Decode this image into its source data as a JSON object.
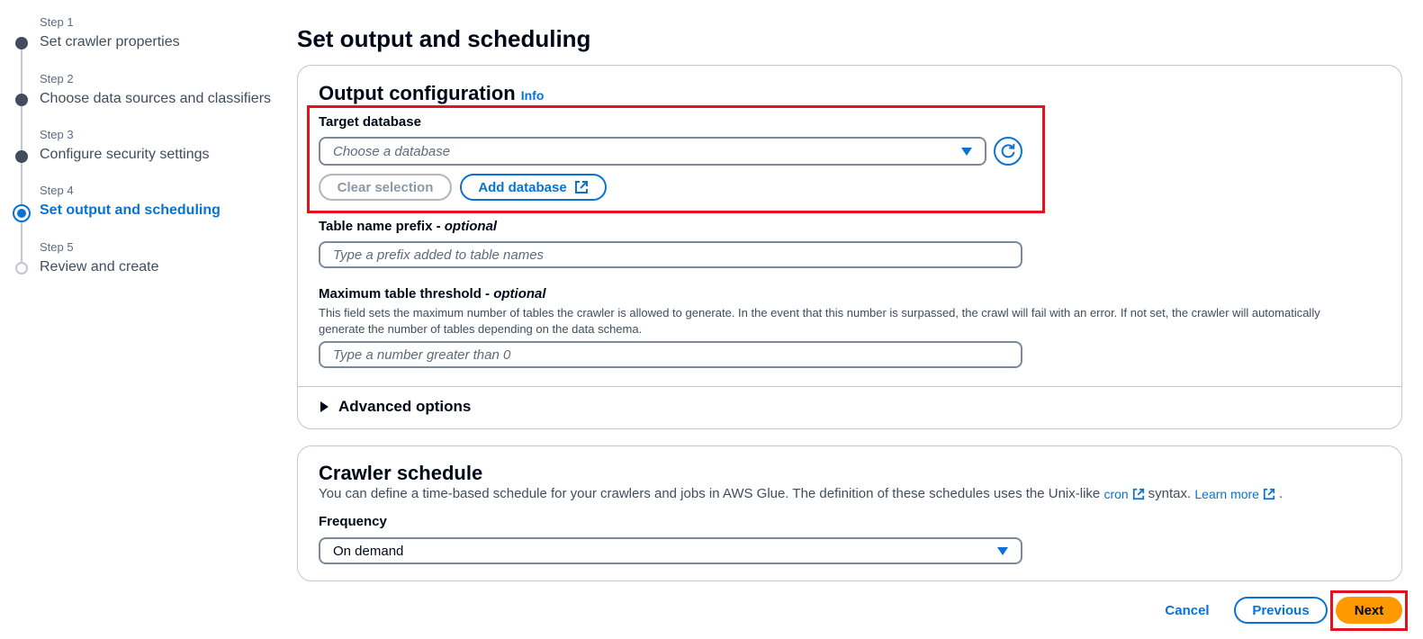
{
  "steps": [
    {
      "number": "Step 1",
      "title": "Set crawler properties",
      "state": "complete"
    },
    {
      "number": "Step 2",
      "title": "Choose data sources and classifiers",
      "state": "complete"
    },
    {
      "number": "Step 3",
      "title": "Configure security settings",
      "state": "complete"
    },
    {
      "number": "Step 4",
      "title": "Set output and scheduling",
      "state": "current"
    },
    {
      "number": "Step 5",
      "title": "Review and create",
      "state": "pending"
    }
  ],
  "page": {
    "title": "Set output and scheduling"
  },
  "output": {
    "title": "Output configuration",
    "info_label": "Info",
    "target_database": {
      "label": "Target database",
      "placeholder": "Choose a database",
      "clear_label": "Clear selection",
      "add_label": "Add database"
    },
    "table_prefix": {
      "label": "Table name prefix - ",
      "optional": "optional",
      "placeholder": "Type a prefix added to table names"
    },
    "max_threshold": {
      "label": "Maximum table threshold - ",
      "optional": "optional",
      "description": "This field sets the maximum number of tables the crawler is allowed to generate. In the event that this number is surpassed, the crawl will fail with an error. If not set, the crawler will automatically generate the number of tables depending on the data schema.",
      "placeholder": "Type a number greater than 0"
    },
    "advanced_label": "Advanced options"
  },
  "schedule": {
    "title": "Crawler schedule",
    "description_before": "You can define a time-based schedule for your crawlers and jobs in AWS Glue. The definition of these schedules uses the Unix-like",
    "cron_link": "cron",
    "description_middle": "syntax.",
    "learn_more": "Learn more",
    "description_end": ".",
    "frequency_label": "Frequency",
    "frequency_value": "On demand"
  },
  "footer": {
    "cancel": "Cancel",
    "previous": "Previous",
    "next": "Next"
  },
  "colors": {
    "accent": "#0972d3",
    "primary_button": "#ff9900",
    "highlight": "#e0141e"
  },
  "icons": {
    "refresh": "refresh-icon",
    "external": "external-link-icon",
    "caret": "caret-down-icon",
    "expand": "caret-right-icon"
  }
}
